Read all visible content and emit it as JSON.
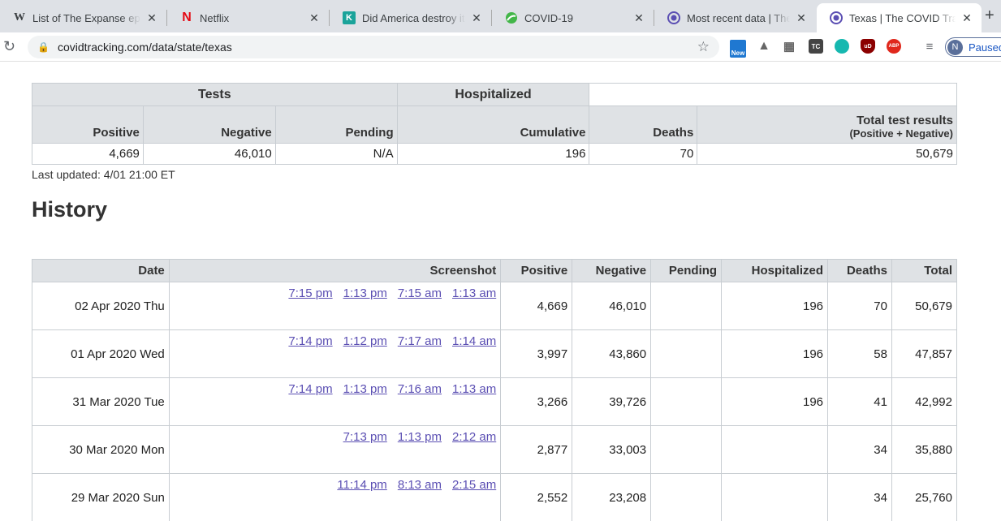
{
  "browser": {
    "tabs": [
      {
        "title": "List of The Expanse episodes",
        "favicon": "W"
      },
      {
        "title": "Netflix",
        "favicon": "N"
      },
      {
        "title": "Did America destroy its",
        "favicon": "K"
      },
      {
        "title": "COVID-19",
        "favicon": ""
      },
      {
        "title": "Most recent data | The COVID",
        "favicon": ""
      },
      {
        "title": "Texas | The COVID Tracking",
        "favicon": ""
      }
    ],
    "url": "covidtracking.com/data/state/texas",
    "ext_new": "New",
    "ext_tc": "TC",
    "ext_ud": "uD",
    "ext_abp": "ABP",
    "profile_initial": "N",
    "profile_label": "Paused",
    "accent": "#5a6f9a"
  },
  "summary": {
    "group_headers": [
      "Tests",
      "Hospitalized"
    ],
    "columns": [
      "Positive",
      "Negative",
      "Pending",
      "Cumulative",
      "Deaths",
      "Total test results"
    ],
    "total_sub": "(Positive + Negative)",
    "values": [
      "4,669",
      "46,010",
      "N/A",
      "196",
      "70",
      "50,679"
    ],
    "last_updated": "Last updated: 4/01 21:00 ET"
  },
  "history": {
    "title": "History",
    "columns": [
      "Date",
      "Screenshot",
      "Positive",
      "Negative",
      "Pending",
      "Hospitalized",
      "Deaths",
      "Total"
    ],
    "rows": [
      {
        "date": "02 Apr 2020 Thu",
        "shots": [
          "7:15 pm",
          "1:13 pm",
          "7:15 am",
          "1:13 am"
        ],
        "positive": "4,669",
        "negative": "46,010",
        "pending": "",
        "hospitalized": "196",
        "deaths": "70",
        "total": "50,679"
      },
      {
        "date": "01 Apr 2020 Wed",
        "shots": [
          "7:14 pm",
          "1:12 pm",
          "7:17 am",
          "1:14 am"
        ],
        "positive": "3,997",
        "negative": "43,860",
        "pending": "",
        "hospitalized": "196",
        "deaths": "58",
        "total": "47,857"
      },
      {
        "date": "31 Mar 2020 Tue",
        "shots": [
          "7:14 pm",
          "1:13 pm",
          "7:16 am",
          "1:13 am"
        ],
        "positive": "3,266",
        "negative": "39,726",
        "pending": "",
        "hospitalized": "196",
        "deaths": "41",
        "total": "42,992"
      },
      {
        "date": "30 Mar 2020 Mon",
        "shots": [
          "7:13 pm",
          "1:13 pm",
          "2:12 am"
        ],
        "positive": "2,877",
        "negative": "33,003",
        "pending": "",
        "hospitalized": "",
        "deaths": "34",
        "total": "35,880"
      },
      {
        "date": "29 Mar 2020 Sun",
        "shots": [
          "11:14 pm",
          "8:13 am",
          "2:15 am"
        ],
        "positive": "2,552",
        "negative": "23,208",
        "pending": "",
        "hospitalized": "",
        "deaths": "34",
        "total": "25,760"
      }
    ]
  }
}
